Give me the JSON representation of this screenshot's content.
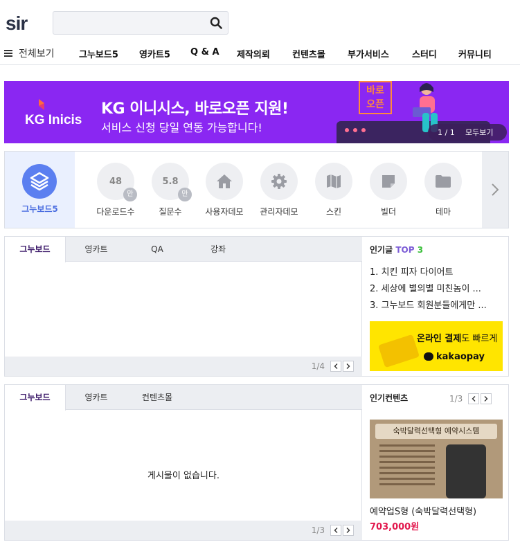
{
  "header": {
    "logo": "sir",
    "search_placeholder": ""
  },
  "nav": {
    "all_label": "전체보기",
    "items": [
      "그누보드5",
      "영카트5",
      "Q & A",
      "제작의뢰",
      "컨텐츠몰",
      "부가서비스",
      "스터디",
      "커뮤니티"
    ]
  },
  "banner": {
    "brand": "KG Inicis",
    "title": "KG 이니시스, 바로오픈 지원!",
    "subtitle": "서비스 신청 당일 연동 가능합니다!",
    "badge_line1": "바로",
    "badge_line2": "오픈",
    "counter": "1 / 1",
    "view_all": "모두보기"
  },
  "quick": {
    "primary_label": "그누보드5",
    "items": [
      {
        "value": "48",
        "unit": "만",
        "label": "다운로드수"
      },
      {
        "value": "5.8",
        "unit": "만",
        "label": "질문수"
      },
      {
        "icon": "home-icon",
        "label": "사용자데모"
      },
      {
        "icon": "gear-icon",
        "label": "관리자데모"
      },
      {
        "icon": "map-icon",
        "label": "스킨"
      },
      {
        "icon": "note-icon",
        "label": "빌더"
      },
      {
        "icon": "folder-icon",
        "label": "테마"
      }
    ]
  },
  "board1": {
    "tabs": [
      "그누보드",
      "영카트",
      "QA",
      "강좌"
    ],
    "page": "1/4",
    "hot_title": "인기글",
    "hot_top": "TOP",
    "hot_num": "3",
    "hot_items": [
      "1. 치킨 피자 다이어트",
      "2. 세상에 별의별 미친놈이 ...",
      "3. 그누보드 회원분들에게만 ..."
    ],
    "ad": {
      "line1_bold": "온라인 결제",
      "line1_rest": "도 빠르게",
      "line2": "kakaopay"
    }
  },
  "board2": {
    "tabs": [
      "그누보드",
      "영카트",
      "컨텐츠몰"
    ],
    "empty": "게시물이 없습니다.",
    "page": "1/3",
    "side_title": "인기컨텐츠",
    "side_page": "1/3",
    "product_img_title": "숙박달력선택형 예약시스템",
    "product_name": "예약업S형 (숙박달력선택형)",
    "product_price": "703,000원"
  },
  "colors": {
    "banner_bg": "#8a27f2",
    "accent": "#3a1768",
    "price": "#e2184d",
    "kakao": "#ffe500"
  }
}
